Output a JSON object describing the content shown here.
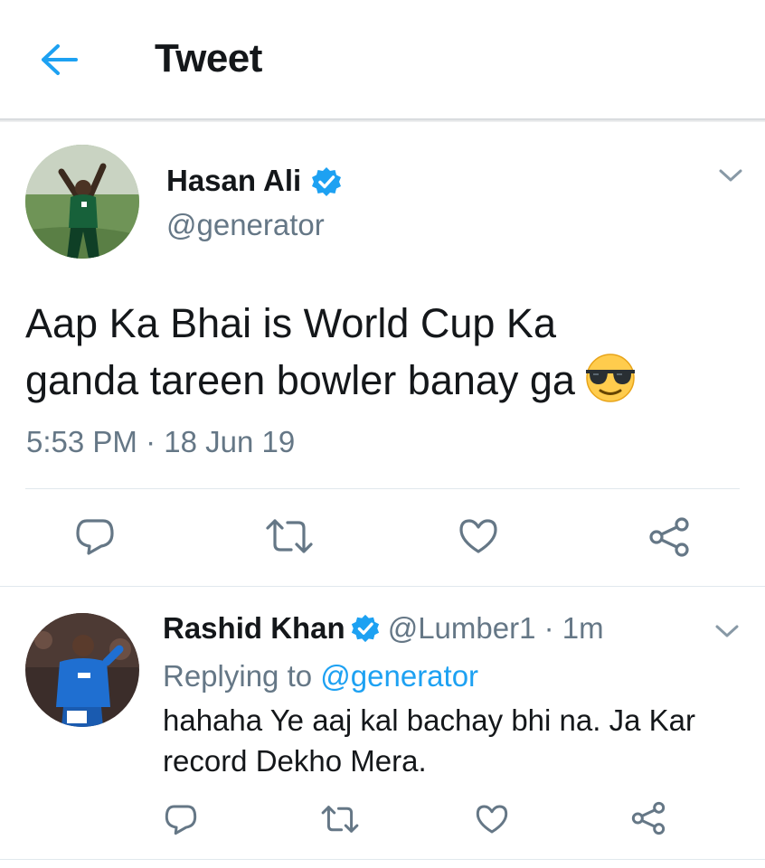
{
  "header": {
    "title": "Tweet",
    "back_icon": "back-arrow-icon"
  },
  "tweet": {
    "author_name": "Hasan Ali",
    "handle": "@generator",
    "verified": true,
    "text_line1": "Aap Ka Bhai is World Cup Ka",
    "text_line2": "ganda tareen bowler banay ga",
    "emoji": "smiling-face-with-sunglasses",
    "time": "5:53 PM",
    "separator": "·",
    "date": "18 Jun 19",
    "actions": [
      "reply-icon",
      "retweet-icon",
      "like-icon",
      "share-icon"
    ]
  },
  "reply": {
    "author_name": "Rashid Khan",
    "handle": "@Lumber1",
    "separator": "·",
    "age": "1m",
    "verified": true,
    "replying_prefix": "Replying to",
    "replying_to": "@generator",
    "text_line1": "hahaha Ye aaj kal bachay bhi na. Ja Kar",
    "text_line2": "record Dekho Mera.",
    "actions": [
      "reply-icon",
      "retweet-icon",
      "like-icon",
      "share-icon"
    ]
  },
  "colors": {
    "accent": "#1da1f2",
    "muted": "#657786",
    "text": "#14171a",
    "divider": "#e1e8ed"
  }
}
